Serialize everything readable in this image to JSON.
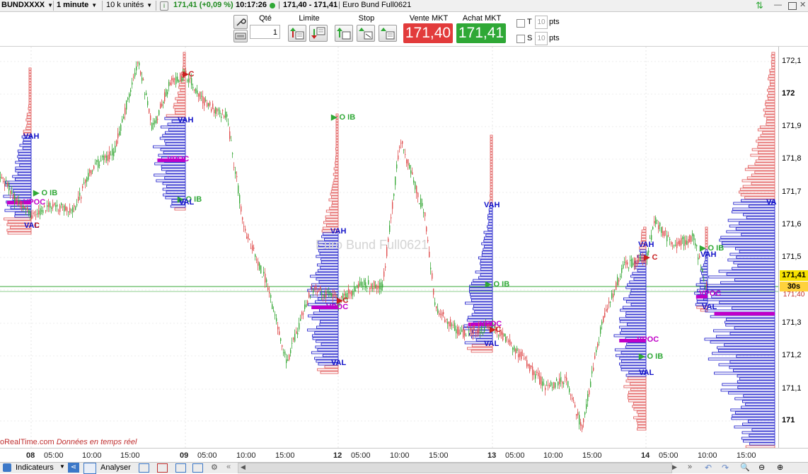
{
  "toolbar": {
    "instrument": "BUNDXXXX",
    "timeframe": "1 minute",
    "units": "10 k unités",
    "price_change": "171,41 (+0,09 %)",
    "time": "10:17:26",
    "bid_ask": "171,40 - 171,41",
    "description": "Euro Bund Full0621"
  },
  "order": {
    "qty_label": "Qté",
    "qty_value": "1",
    "limit_label": "Limite",
    "stop_label": "Stop",
    "sell_label": "Vente MKT",
    "sell_price": "171,40",
    "buy_label": "Achat MKT",
    "buy_price": "171,41",
    "t_label": "T",
    "s_label": "S",
    "t_value": "10",
    "s_value": "10",
    "pts_label": "pts"
  },
  "chart": {
    "watermark": "Euro Bund Full0621",
    "source": "oRealTime.com",
    "source_note": "Données en temps réel",
    "current_price": "171,41",
    "timer": "30s",
    "bid_price": "171,40",
    "y_ticks": [
      "172,1",
      "172",
      "171,9",
      "171,8",
      "171,7",
      "171,6",
      "171,5",
      "171,4",
      "171,3",
      "171,2",
      "171,1",
      "171"
    ],
    "x_ticks": [
      "08",
      "05:00",
      "10:00",
      "15:00",
      "09",
      "05:00",
      "10:00",
      "15:00",
      "12",
      "05:00",
      "10:00",
      "15:00",
      "13",
      "05:00",
      "10:00",
      "15:00",
      "14",
      "05:00",
      "10:00",
      "15:00"
    ],
    "profile_labels": {
      "vah": "VAH",
      "val": "VAL",
      "poc": "VPOC",
      "oib": "O IB",
      "c": "C"
    }
  },
  "bottom": {
    "indicators": "Indicateurs",
    "analyze": "Analyser"
  },
  "colors": {
    "sell": "#e23b3b",
    "buy": "#2fa836",
    "profile_blue": "#1010c8",
    "profile_red": "#e05050",
    "poc": "#c000c8"
  }
}
